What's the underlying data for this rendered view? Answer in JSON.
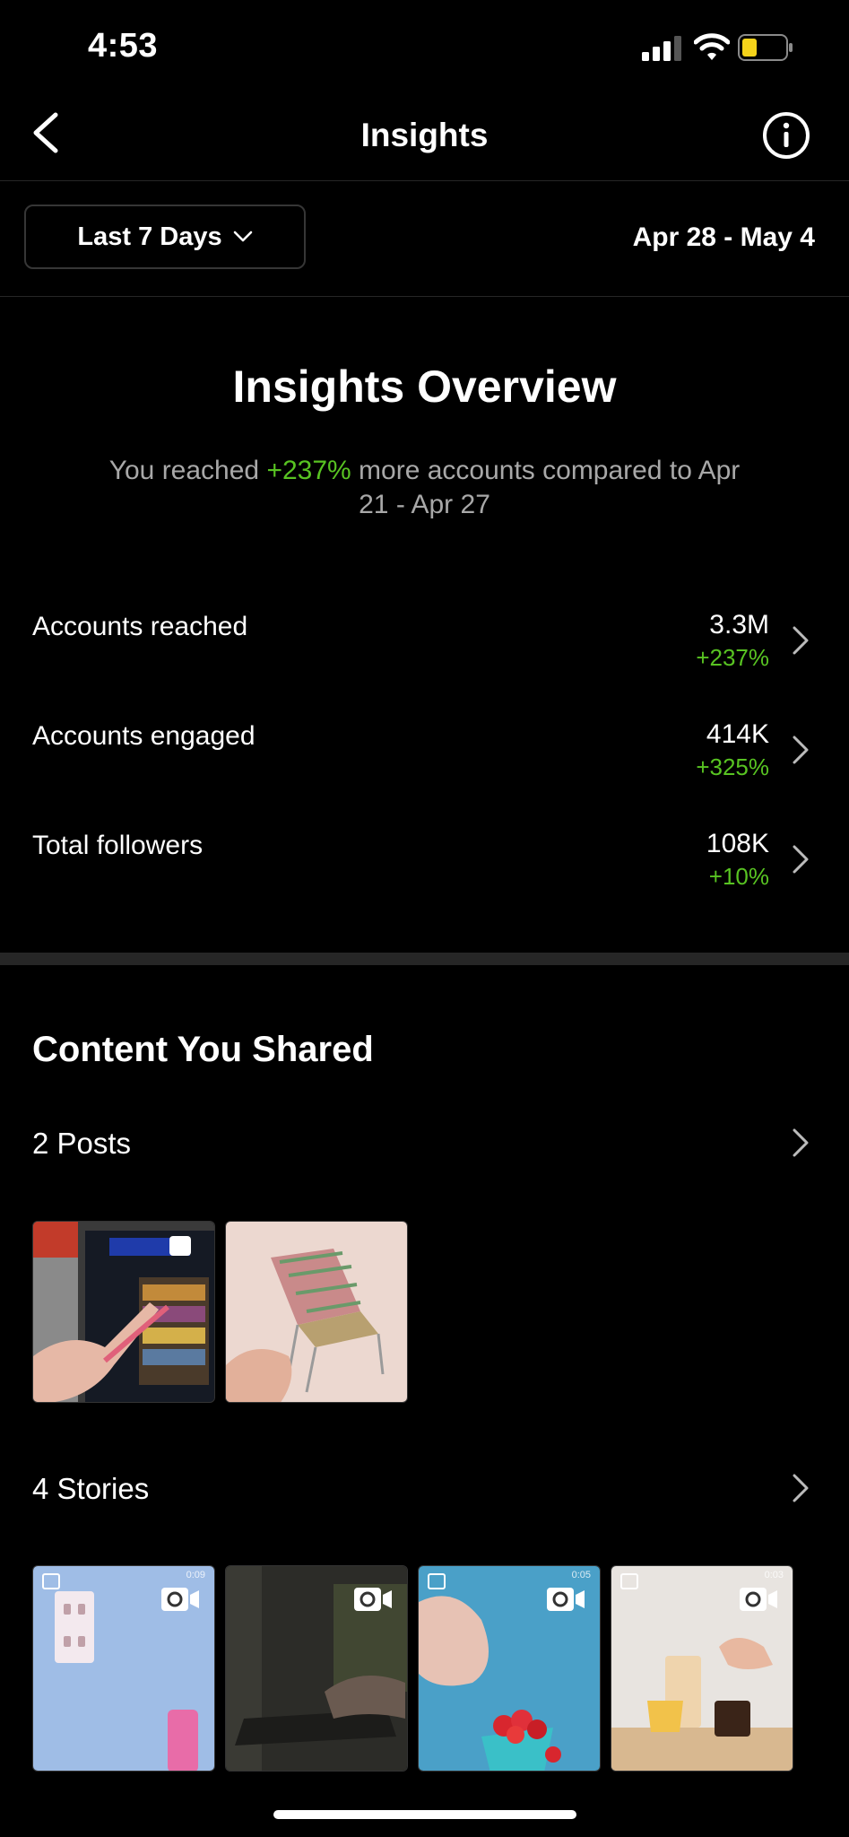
{
  "status_bar": {
    "time": "4:53"
  },
  "nav": {
    "title": "Insights"
  },
  "filter": {
    "range_label": "Last 7 Days",
    "date_range": "Apr 28 - May 4"
  },
  "overview": {
    "title": "Insights Overview",
    "subtitle_prefix": "You reached ",
    "subtitle_highlight": "+237%",
    "subtitle_line1_rest": " more accounts compared to Apr",
    "subtitle_line2": "21 - Apr 27"
  },
  "metrics": [
    {
      "label": "Accounts reached",
      "value": "3.3M",
      "delta": "+237%"
    },
    {
      "label": "Accounts engaged",
      "value": "414K",
      "delta": "+325%"
    },
    {
      "label": "Total followers",
      "value": "108K",
      "delta": "+10%"
    }
  ],
  "content": {
    "title": "Content You Shared",
    "posts_label": "2 Posts",
    "stories_label": "4 Stories",
    "story_times": [
      "0:09",
      "",
      "0:05",
      "0:03"
    ]
  },
  "colors": {
    "accent_green": "#58c322",
    "divider": "#262626",
    "muted_text": "#a8a8a8"
  }
}
